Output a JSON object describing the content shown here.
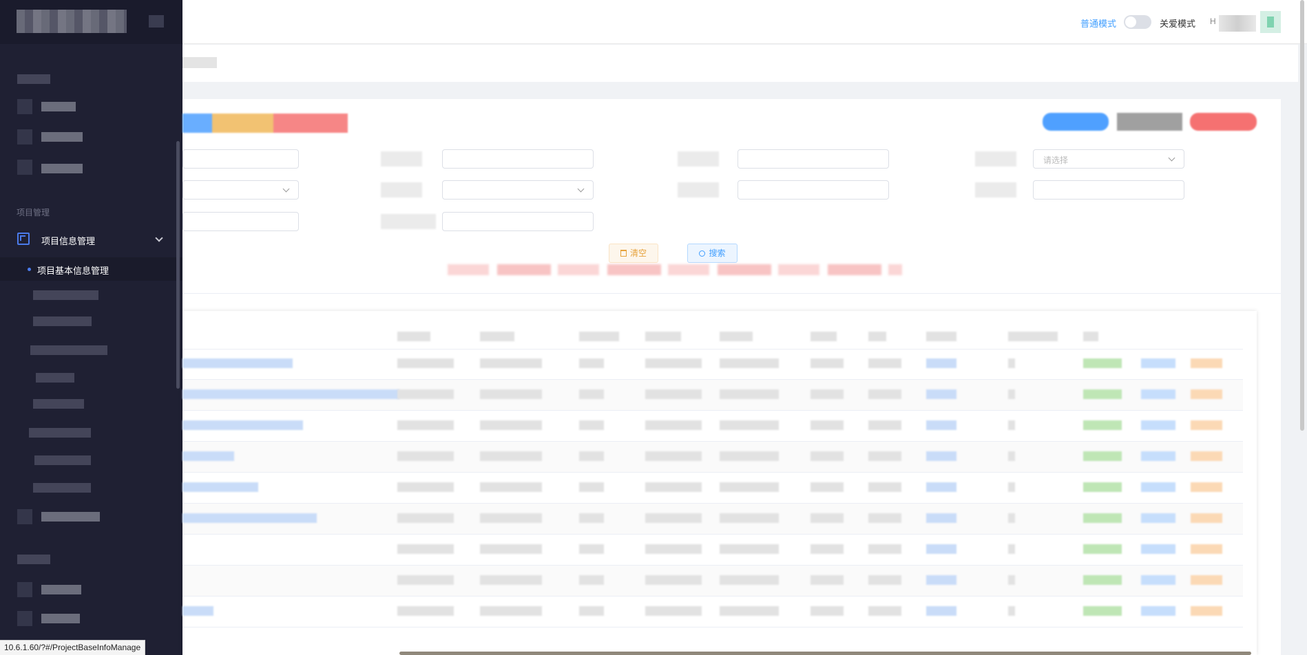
{
  "sidebar": {
    "section_label": "项目管理",
    "active_group": "项目信息管理",
    "active_item": "项目基本信息管理"
  },
  "header": {
    "mode_normal": "普通模式",
    "mode_care": "关爱模式",
    "user_initial": "H"
  },
  "filters": {
    "select_placeholder": "请选择",
    "clear_label": "清空",
    "search_label": "搜索"
  },
  "status_bar": {
    "url": "10.6.1.60/?#/ProjectBaseInfoManage"
  },
  "colors": {
    "sidebar_bg": "#1f2033",
    "accent": "#409eff",
    "warning": "#e6a23c"
  }
}
